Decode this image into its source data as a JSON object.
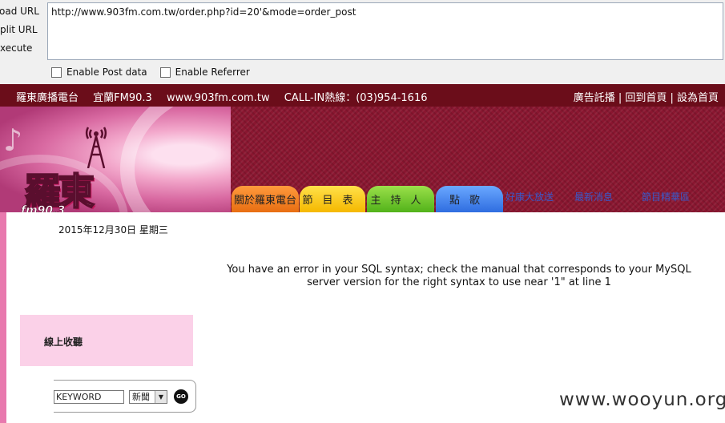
{
  "toolpanel": {
    "labels": [
      "oad URL",
      "plit URL",
      "xecute"
    ],
    "url_value": "http://www.903fm.com.tw/order.php?id=20'&mode=order_post",
    "enable_post_label": "Enable Post data",
    "enable_referrer_label": "Enable Referrer"
  },
  "topbar": {
    "station": "羅東廣播電台",
    "freq": "宜蘭FM90.3",
    "site": "www.903fm.com.tw",
    "callin": "CALL-IN熱線：(03)954-1616",
    "right_links": "廣告託播 | 回到首頁 | 設為首頁"
  },
  "logo": {
    "text": "羅東",
    "fm": "fm90.3"
  },
  "nav": {
    "tabs": [
      "關於羅東電台",
      "節目表",
      "主持人",
      "點歌"
    ],
    "links": [
      "好康大放送",
      "最新消息",
      "節目精華區"
    ]
  },
  "content": {
    "date": "2015年12月30日 星期三",
    "error": "You have an error in your SQL syntax; check the manual that corresponds to your MySQL server version for the right syntax to use near '1\" at line 1",
    "listen_label": "線上收聽"
  },
  "search": {
    "keyword": "KEYWORD",
    "category": "新聞",
    "go": "GO"
  },
  "watermark": "www.wooyun.org"
}
